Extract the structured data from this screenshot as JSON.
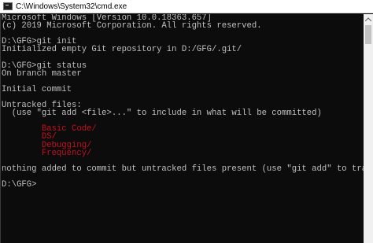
{
  "window": {
    "title": "C:\\Windows\\System32\\cmd.exe"
  },
  "console": {
    "lines": [
      {
        "text": "Microsoft Windows [Version 10.0.18363.657]",
        "color": "default"
      },
      {
        "text": "(c) 2019 Microsoft Corporation. All rights reserved.",
        "color": "default"
      },
      {
        "text": "",
        "color": "default"
      },
      {
        "text": "D:\\GFG>git init",
        "color": "default"
      },
      {
        "text": "Initialized empty Git repository in D:/GFG/.git/",
        "color": "default"
      },
      {
        "text": "",
        "color": "default"
      },
      {
        "text": "D:\\GFG>git status",
        "color": "default"
      },
      {
        "text": "On branch master",
        "color": "default"
      },
      {
        "text": "",
        "color": "default"
      },
      {
        "text": "Initial commit",
        "color": "default"
      },
      {
        "text": "",
        "color": "default"
      },
      {
        "text": "Untracked files:",
        "color": "default"
      },
      {
        "text": "  (use \"git add <file>...\" to include in what will be committed)",
        "color": "default"
      },
      {
        "text": "",
        "color": "default"
      },
      {
        "text": "        Basic Code/",
        "color": "red"
      },
      {
        "text": "        DS/",
        "color": "red"
      },
      {
        "text": "        Debugging/",
        "color": "red"
      },
      {
        "text": "        Frequency/",
        "color": "red"
      },
      {
        "text": "",
        "color": "default"
      },
      {
        "text": "nothing added to commit but untracked files present (use \"git add\" to track)",
        "color": "default"
      },
      {
        "text": "",
        "color": "default"
      },
      {
        "text": "D:\\GFG>",
        "color": "default"
      }
    ]
  },
  "colors": {
    "background": "#0c0c0c",
    "text": "#c0c0c0",
    "untracked": "#c50f1f"
  },
  "icons": {
    "app": "console-app-icon",
    "scroll_up": "scroll-up-arrow-icon"
  }
}
